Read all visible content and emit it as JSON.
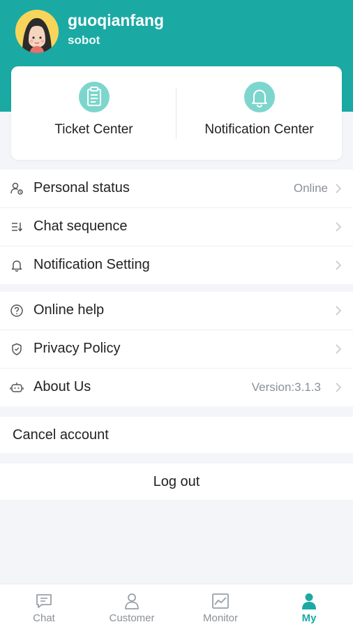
{
  "colors": {
    "brand": "#1ba9a4",
    "brand_light": "#7dd6cd",
    "text_primary": "#222222",
    "text_secondary": "#8a9099",
    "background": "#f3f5f8"
  },
  "profile": {
    "name": "guoqianfang",
    "company": "sobot",
    "avatar_icon": "girl-avatar-icon"
  },
  "quick_actions": [
    {
      "label": "Ticket Center",
      "icon": "clipboard-icon"
    },
    {
      "label": "Notification Center",
      "icon": "bell-icon"
    }
  ],
  "settings_group_1": [
    {
      "label": "Personal status",
      "value": "Online",
      "icon": "person-status-icon"
    },
    {
      "label": "Chat sequence",
      "value": "",
      "icon": "sort-list-icon"
    },
    {
      "label": "Notification Setting",
      "value": "",
      "icon": "bell-outline-icon"
    }
  ],
  "settings_group_2": [
    {
      "label": "Online help",
      "value": "",
      "icon": "help-circle-icon"
    },
    {
      "label": "Privacy Policy",
      "value": "",
      "icon": "shield-icon"
    },
    {
      "label": "About Us",
      "value": "Version:3.1.3",
      "icon": "robot-icon"
    }
  ],
  "account": {
    "cancel_label": "Cancel account",
    "logout_label": "Log out"
  },
  "tabbar": [
    {
      "label": "Chat",
      "icon": "chat-bubble-icon",
      "active": false
    },
    {
      "label": "Customer",
      "icon": "customer-icon",
      "active": false
    },
    {
      "label": "Monitor",
      "icon": "monitor-chart-icon",
      "active": false
    },
    {
      "label": "My",
      "icon": "user-icon",
      "active": true
    }
  ]
}
